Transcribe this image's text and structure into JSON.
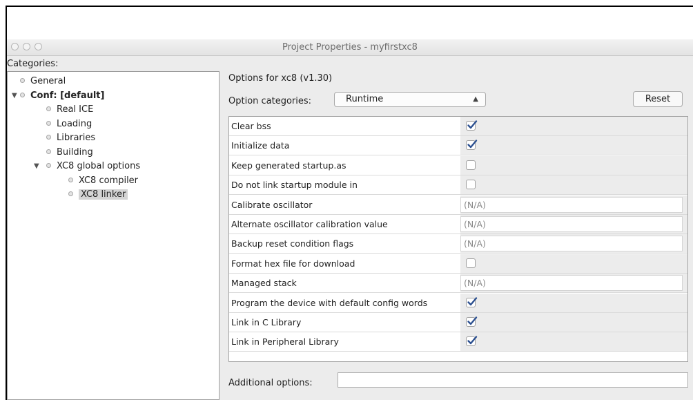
{
  "window": {
    "title": "Project Properties - myfirstxc8"
  },
  "sidebar": {
    "label": "Categories:",
    "nodes": [
      {
        "label": "General",
        "level": 0,
        "expanded": null,
        "bold": false,
        "selected": false
      },
      {
        "label": "Conf: [default]",
        "level": 0,
        "expanded": true,
        "bold": true,
        "selected": false
      },
      {
        "label": "Real ICE",
        "level": 1,
        "expanded": null,
        "bold": false,
        "selected": false
      },
      {
        "label": "Loading",
        "level": 1,
        "expanded": null,
        "bold": false,
        "selected": false
      },
      {
        "label": "Libraries",
        "level": 1,
        "expanded": null,
        "bold": false,
        "selected": false
      },
      {
        "label": "Building",
        "level": 1,
        "expanded": null,
        "bold": false,
        "selected": false
      },
      {
        "label": "XC8 global options",
        "level": 1,
        "expanded": true,
        "bold": false,
        "selected": false
      },
      {
        "label": "XC8 compiler",
        "level": 2,
        "expanded": null,
        "bold": false,
        "selected": false
      },
      {
        "label": "XC8 linker",
        "level": 2,
        "expanded": null,
        "bold": false,
        "selected": true
      }
    ]
  },
  "main": {
    "options_title": "Options for xc8 (v1.30)",
    "option_categories_label": "Option categories:",
    "option_categories_value": "Runtime",
    "reset_label": "Reset",
    "rows": [
      {
        "name": "Clear bss",
        "type": "checkbox",
        "checked": true
      },
      {
        "name": "Initialize data",
        "type": "checkbox",
        "checked": true
      },
      {
        "name": "Keep generated startup.as",
        "type": "checkbox",
        "checked": false
      },
      {
        "name": "Do not link startup module in",
        "type": "checkbox",
        "checked": false
      },
      {
        "name": "Calibrate oscillator",
        "type": "text",
        "value": "(N/A)"
      },
      {
        "name": "Alternate oscillator calibration value",
        "type": "text",
        "value": "(N/A)"
      },
      {
        "name": "Backup reset condition flags",
        "type": "text",
        "value": "(N/A)"
      },
      {
        "name": "Format hex file for download",
        "type": "checkbox",
        "checked": false
      },
      {
        "name": "Managed stack",
        "type": "text",
        "value": "(N/A)"
      },
      {
        "name": "Program the device with default config words",
        "type": "checkbox",
        "checked": true
      },
      {
        "name": "Link in C Library",
        "type": "checkbox",
        "checked": true
      },
      {
        "name": "Link in Peripheral Library",
        "type": "checkbox",
        "checked": true
      }
    ],
    "additional_options_label": "Additional options:",
    "additional_options_value": ""
  },
  "colors": {
    "checkmark": "#2b4f8f",
    "selection": "#d4d4d4"
  }
}
